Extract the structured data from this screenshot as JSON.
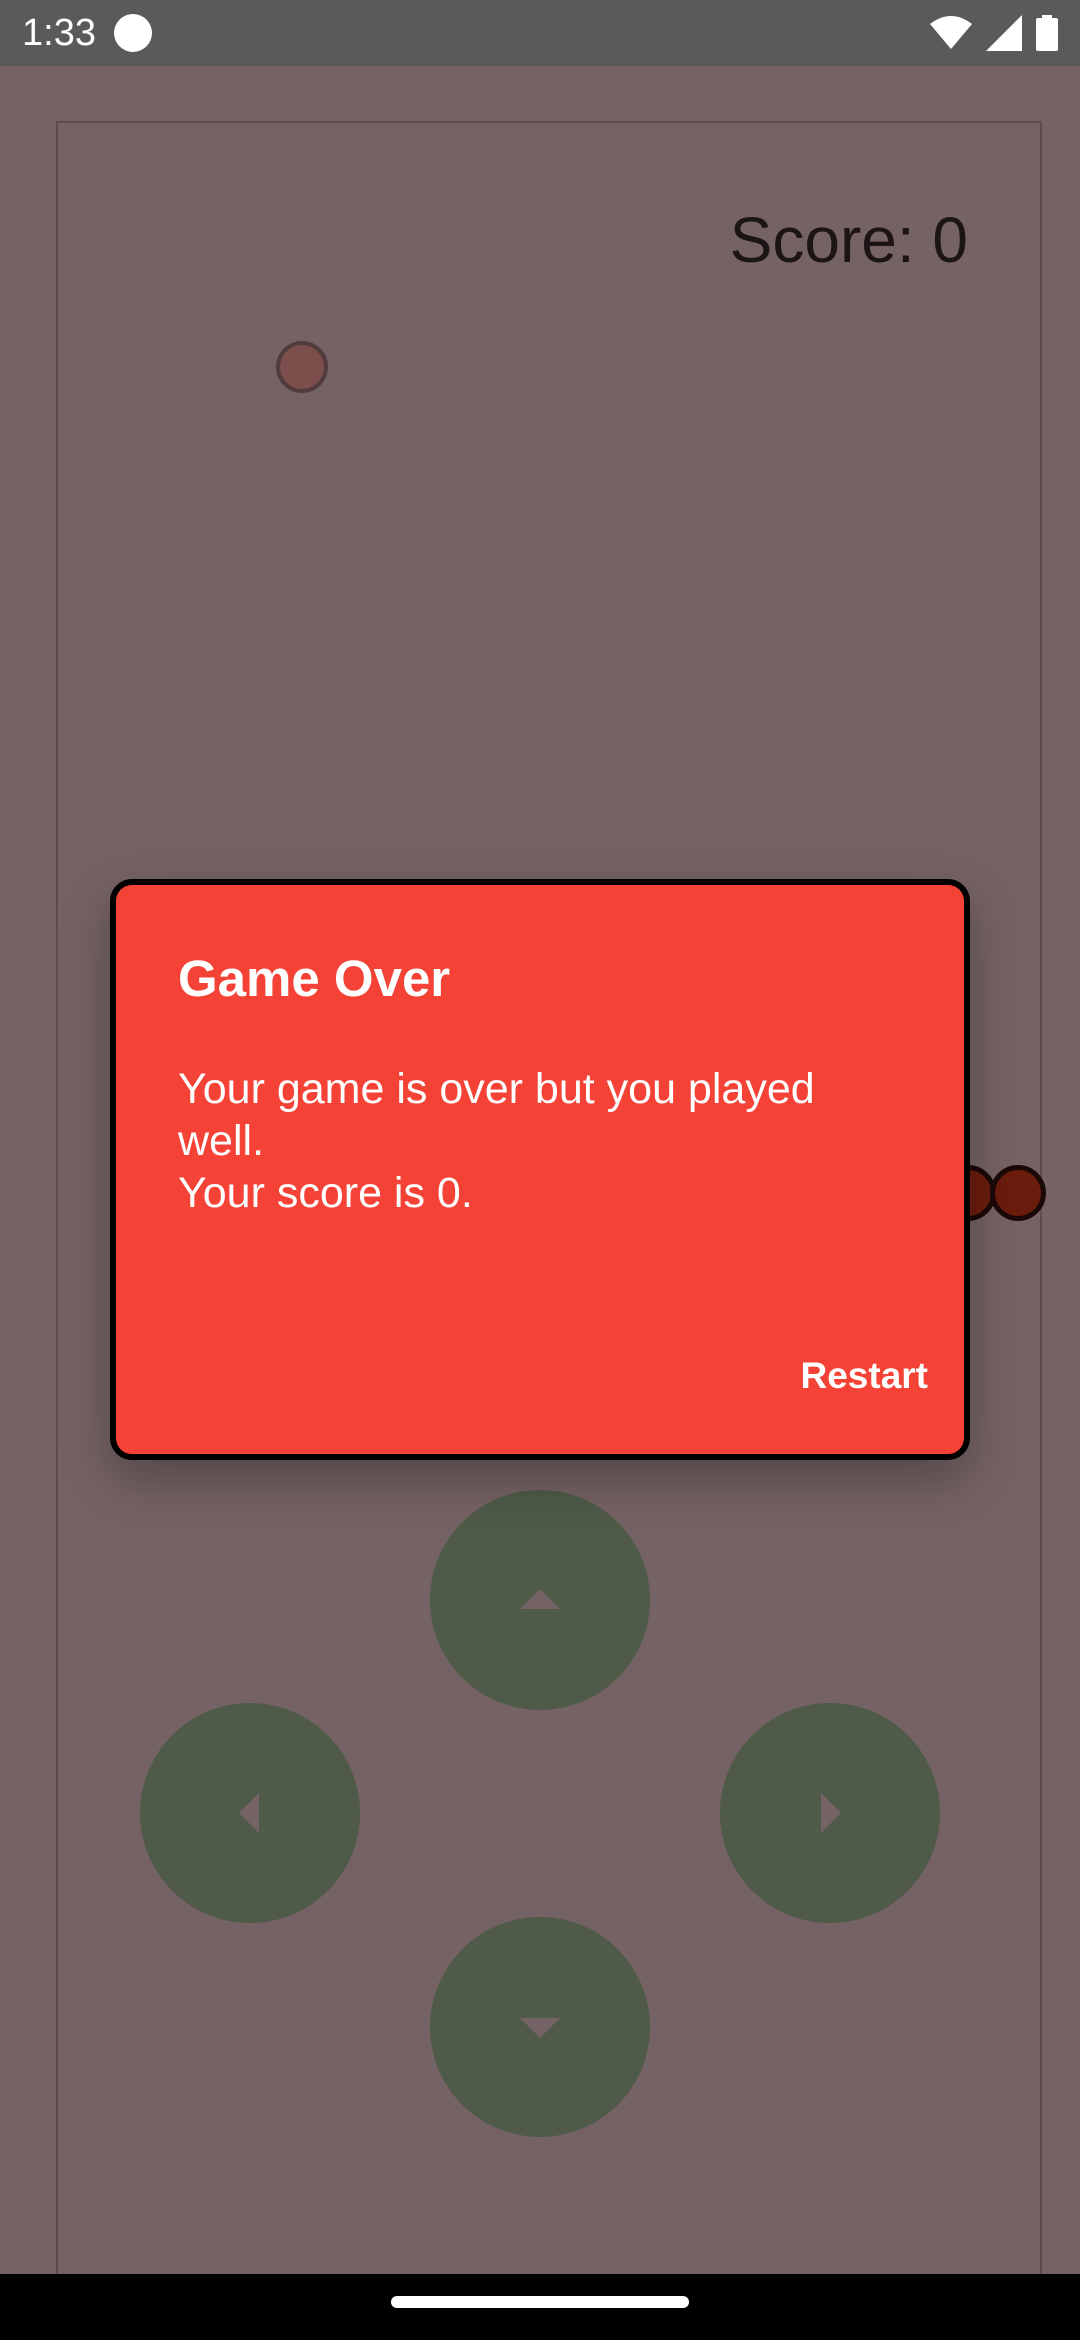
{
  "status_bar": {
    "time": "1:33",
    "icons": [
      "notification-dot-icon",
      "wifi-icon",
      "signal-icon",
      "battery-icon"
    ]
  },
  "game": {
    "score_text": "Score: 0",
    "colors": {
      "background": "#756264",
      "food": "#7d4f4c",
      "snake": "#6b1c0d",
      "dpad": "#4f5a48"
    }
  },
  "dpad": {
    "up_icon": "arrow-up-icon",
    "left_icon": "arrow-left-icon",
    "right_icon": "arrow-right-icon",
    "down_icon": "arrow-down-icon"
  },
  "dialog": {
    "title": "Game Over",
    "message_line1": "Your game is over but you played well.",
    "message_line2": "Your score is 0.",
    "action_label": "Restart",
    "background_color": "#f44236"
  }
}
